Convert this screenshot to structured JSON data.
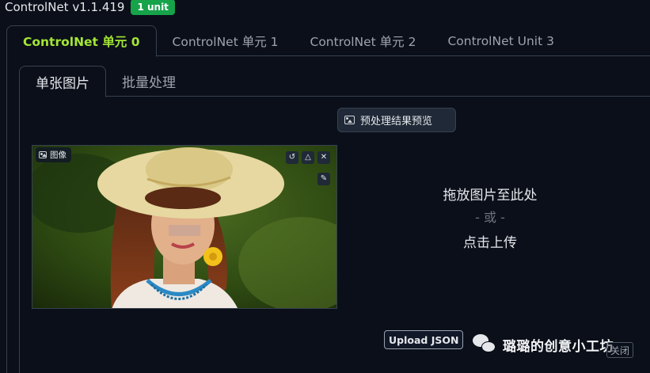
{
  "header": {
    "title": "ControlNet v1.1.419",
    "badge": "1 unit"
  },
  "outer_tabs": [
    {
      "label": "ControlNet 单元 0",
      "active": true
    },
    {
      "label": "ControlNet 单元 1",
      "active": false
    },
    {
      "label": "ControlNet 单元 2",
      "active": false
    },
    {
      "label": "ControlNet Unit 3",
      "active": false
    }
  ],
  "inner_tabs": [
    {
      "label": "单张图片",
      "active": true
    },
    {
      "label": "批量处理",
      "active": false
    }
  ],
  "preview_button": {
    "label": "预处理结果预览",
    "icon": "image-icon"
  },
  "image_panel": {
    "label": "图像",
    "tools": [
      "undo-icon",
      "eraser-icon",
      "close-icon"
    ],
    "extra_tool": "pen-icon"
  },
  "drop_zone": {
    "line1": "拖放图片至此处",
    "line2": "- 或 -",
    "line3": "点击上传"
  },
  "upload_json": {
    "label": "Upload JSON"
  },
  "watermark": {
    "text": "璐璐的创意小工坊",
    "close_label": "关闭"
  },
  "colors": {
    "accent": "#a3e635",
    "badge": "#16a34a",
    "background": "#0b0f19",
    "border": "#374151"
  }
}
